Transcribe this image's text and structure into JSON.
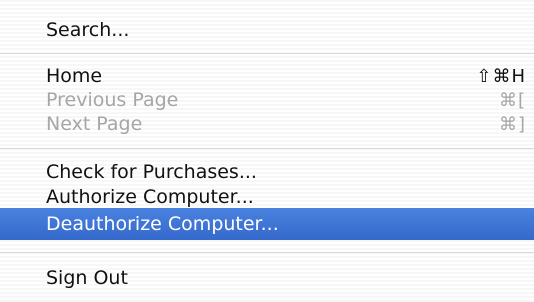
{
  "menu": {
    "items": [
      {
        "label": "Search...",
        "shortcut": "",
        "enabled": true,
        "selected": false
      },
      {
        "label": "Home",
        "shortcut": "⇧⌘H",
        "enabled": true,
        "selected": false
      },
      {
        "label": "Previous Page",
        "shortcut": "⌘[",
        "enabled": false,
        "selected": false
      },
      {
        "label": "Next Page",
        "shortcut": "⌘]",
        "enabled": false,
        "selected": false
      },
      {
        "label": "Check for Purchases...",
        "shortcut": "",
        "enabled": true,
        "selected": false
      },
      {
        "label": "Authorize Computer...",
        "shortcut": "",
        "enabled": true,
        "selected": false
      },
      {
        "label": "Deauthorize Computer...",
        "shortcut": "",
        "enabled": true,
        "selected": true
      },
      {
        "label": "Sign Out",
        "shortcut": "",
        "enabled": true,
        "selected": false
      }
    ],
    "highlight_color": "#3a6fd0",
    "disabled_color": "#a6a6a6"
  }
}
